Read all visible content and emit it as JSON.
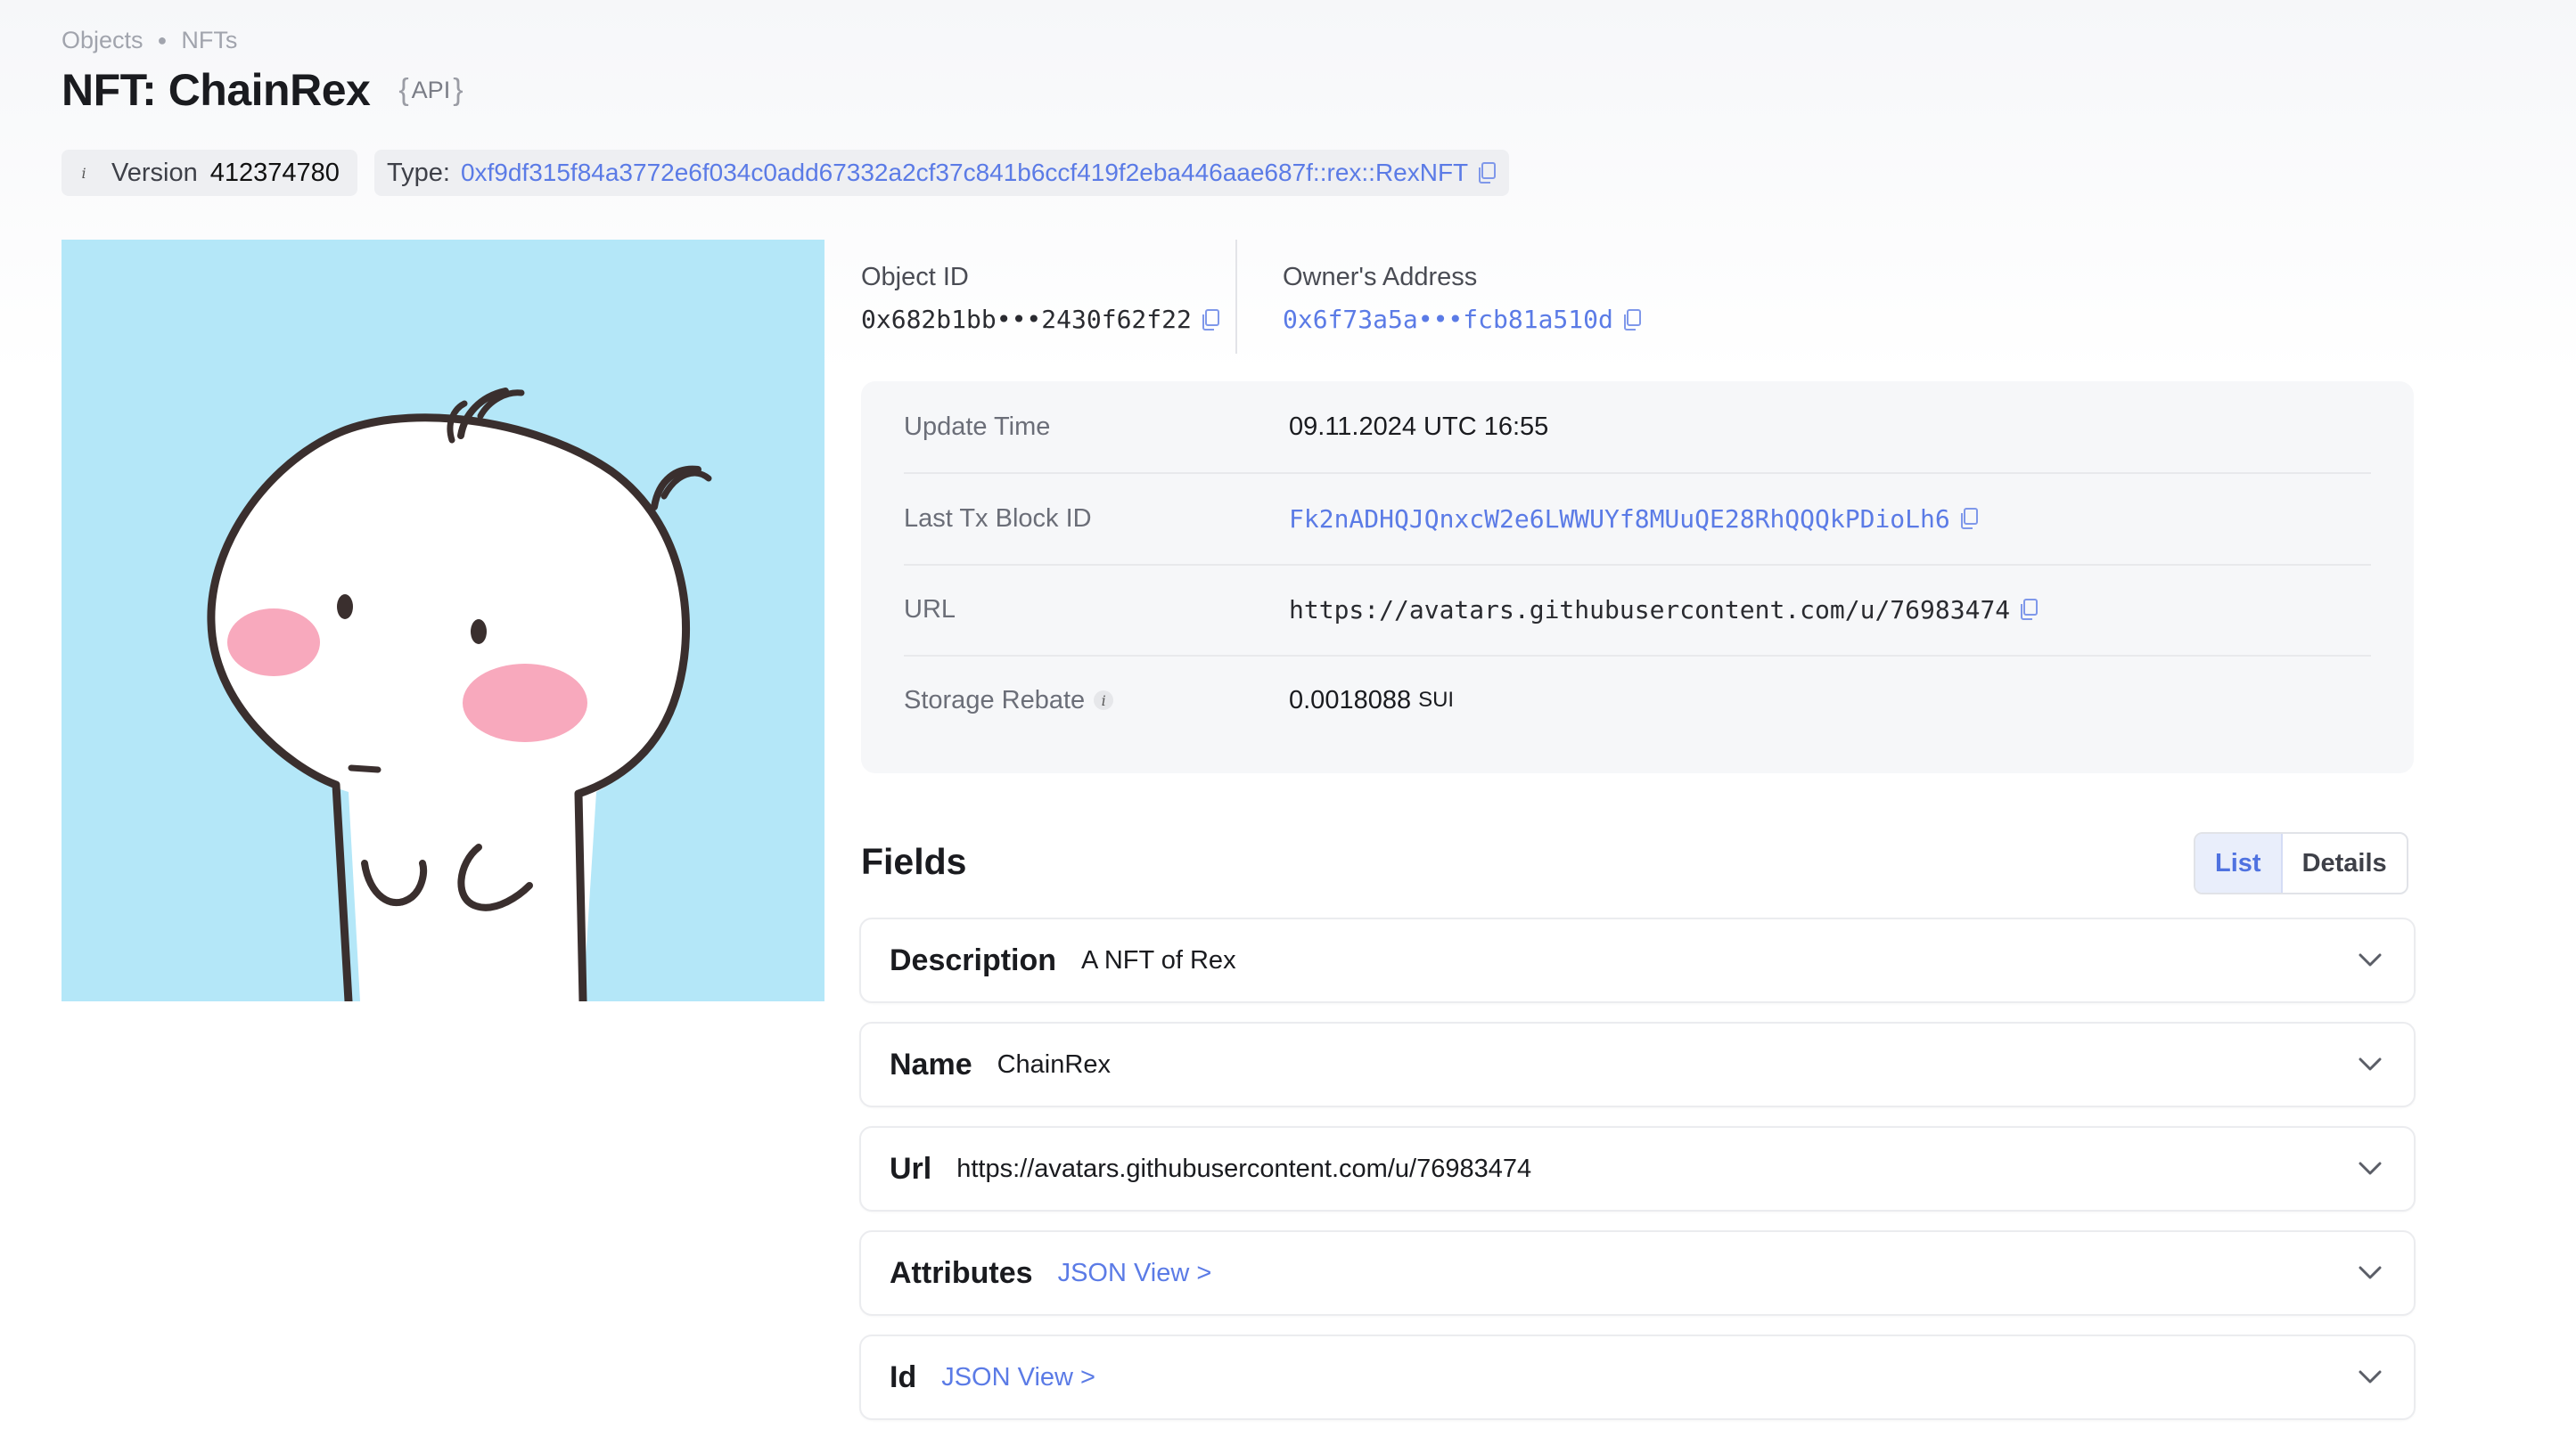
{
  "breadcrumb": [
    "Objects",
    "NFTs"
  ],
  "title": "NFT: ChainRex",
  "api_tag": "API",
  "version": {
    "label": "Version",
    "value": "412374780"
  },
  "type": {
    "label": "Type:",
    "value": "0xf9df315f84a3772e6f034c0add67332a2cf37c841b6ccf419f2eba446aae687f::rex::RexNFT"
  },
  "object_id": {
    "label": "Object ID",
    "value": "0x682b1bb•••2430f62f22"
  },
  "owner": {
    "label": "Owner's Address",
    "value": "0x6f73a5a•••fcb81a510d"
  },
  "details": {
    "update_time": {
      "label": "Update Time",
      "value": "09.11.2024 UTC 16:55"
    },
    "last_tx": {
      "label": "Last Tx Block ID",
      "value": "Fk2nADHQJQnxcW2e6LWWUYf8MUuQE28RhQQQkPDioLh6"
    },
    "url": {
      "label": "URL",
      "value": "https://avatars.githubusercontent.com/u/76983474"
    },
    "storage_rebate": {
      "label": "Storage Rebate",
      "value": "0.0018088",
      "unit": "SUI"
    }
  },
  "fields_section": {
    "title": "Fields",
    "toggle": {
      "list": "List",
      "details": "Details",
      "selected": "List"
    },
    "items": [
      {
        "name": "Description",
        "value": "A NFT of Rex"
      },
      {
        "name": "Name",
        "value": "ChainRex"
      },
      {
        "name": "Url",
        "value": "https://avatars.githubusercontent.com/u/76983474"
      },
      {
        "name": "Attributes",
        "value": "JSON View >"
      },
      {
        "name": "Id",
        "value": "JSON View >"
      }
    ]
  },
  "colors": {
    "accent": "#5b7be6",
    "image_bg": "#b4e7f8",
    "blush": "#f8a9bd"
  },
  "icons": [
    "info-icon",
    "copy-icon",
    "chevron-down-icon"
  ]
}
